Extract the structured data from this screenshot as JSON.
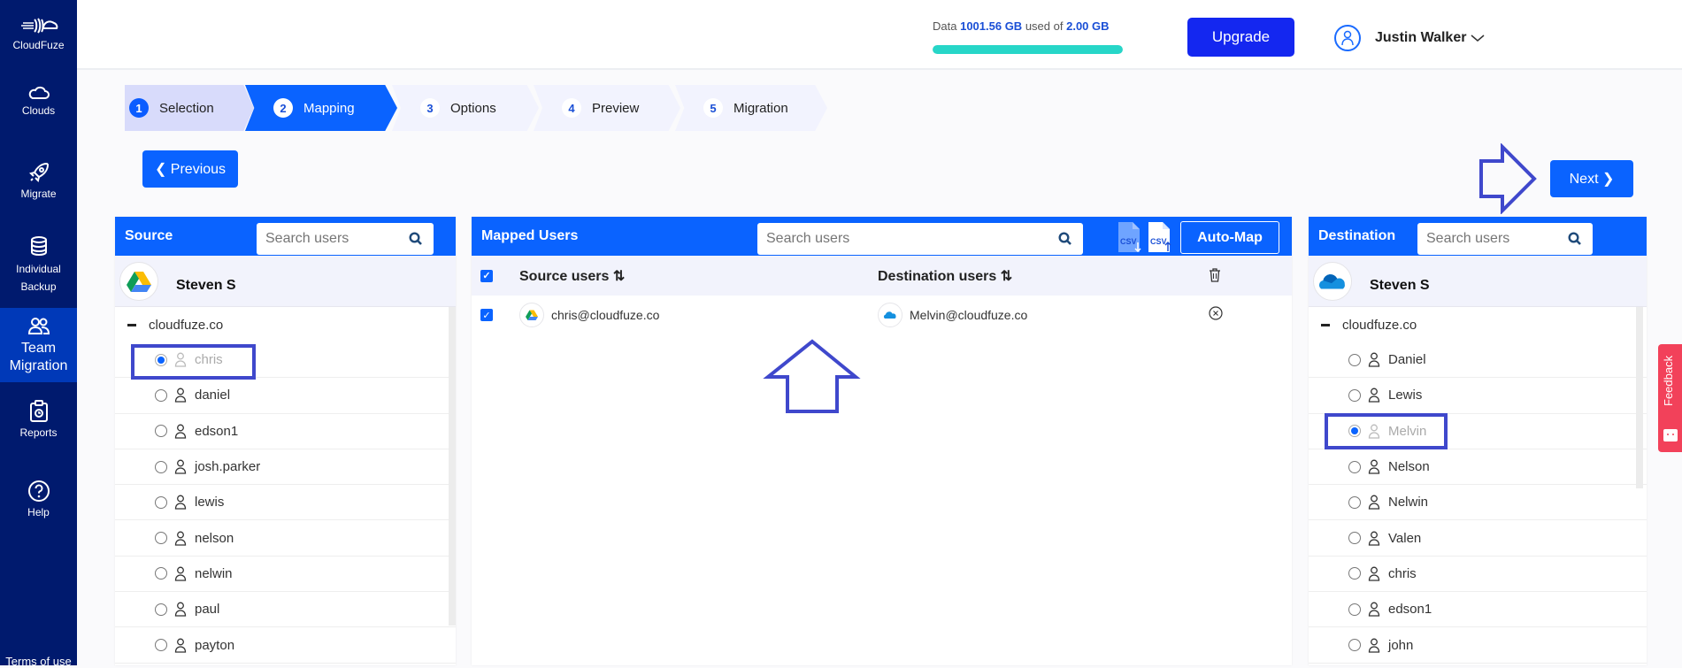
{
  "sidebar": {
    "brand": "CloudFuze",
    "items": [
      {
        "label": "Clouds",
        "icon": "cloud-icon"
      },
      {
        "label": "Migrate",
        "icon": "rocket-icon"
      },
      {
        "label": "Individual Backup",
        "icon": "database-icon"
      },
      {
        "label": "Team Migration",
        "icon": "users-icon",
        "active": true
      },
      {
        "label": "Reports",
        "icon": "clipboard-icon"
      },
      {
        "label": "Help",
        "icon": "help-icon"
      }
    ],
    "terms": "Terms of use"
  },
  "header": {
    "usage_prefix": "Data",
    "usage_used": "1001.56 GB",
    "usage_middle": "used of",
    "usage_total": "2.00 GB",
    "usage_fill_percent": 100,
    "upgrade_label": "Upgrade",
    "user_name": "Justin Walker"
  },
  "steps": [
    {
      "num": "1",
      "label": "Selection",
      "state": "done"
    },
    {
      "num": "2",
      "label": "Mapping",
      "state": "active"
    },
    {
      "num": "3",
      "label": "Options",
      "state": "todo"
    },
    {
      "num": "4",
      "label": "Preview",
      "state": "todo"
    },
    {
      "num": "5",
      "label": "Migration",
      "state": "todo"
    }
  ],
  "nav_buttons": {
    "previous": "Previous",
    "next": "Next"
  },
  "source": {
    "title": "Source",
    "search_placeholder": "Search users",
    "owner": "Steven S",
    "domain": "cloudfuze.co",
    "users": [
      {
        "name": "chris",
        "selected": true
      },
      {
        "name": "daniel"
      },
      {
        "name": "edson1"
      },
      {
        "name": "josh.parker"
      },
      {
        "name": "lewis"
      },
      {
        "name": "nelson"
      },
      {
        "name": "nelwin"
      },
      {
        "name": "paul"
      },
      {
        "name": "payton"
      }
    ]
  },
  "mapped": {
    "title": "Mapped Users",
    "search_placeholder": "Search users",
    "csv_download": "CSV",
    "csv_upload": "CSV",
    "automap_label": "Auto-Map",
    "col_source": "Source users",
    "col_destination": "Destination users",
    "rows": [
      {
        "checked": true,
        "source": "chris@cloudfuze.co",
        "destination": "Melvin@cloudfuze.co"
      }
    ]
  },
  "destination": {
    "title": "Destination",
    "search_placeholder": "Search users",
    "owner": "Steven S",
    "domain": "cloudfuze.co",
    "users": [
      {
        "name": "Daniel"
      },
      {
        "name": "Lewis"
      },
      {
        "name": "Melvin",
        "selected": true
      },
      {
        "name": "Nelson"
      },
      {
        "name": "Nelwin"
      },
      {
        "name": "Valen"
      },
      {
        "name": "chris"
      },
      {
        "name": "edson1"
      },
      {
        "name": "john"
      }
    ]
  },
  "feedback_label": "Feedback",
  "colors": {
    "primary": "#0a63ff",
    "sidebar": "#001a6e",
    "annotation": "#3f48cc",
    "feedback": "#f2415a",
    "usage_bar": "#27d6c8"
  }
}
